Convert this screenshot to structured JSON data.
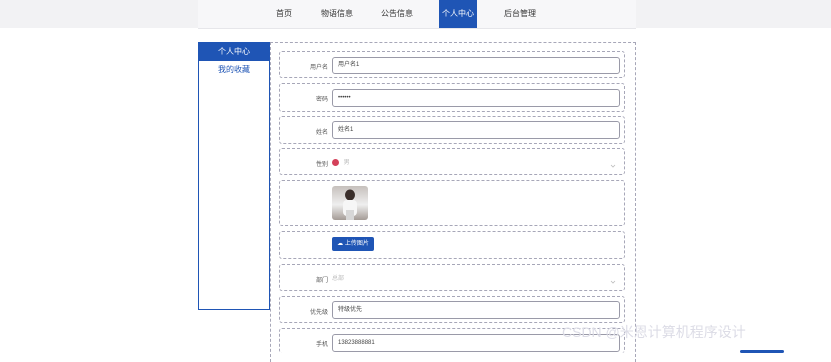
{
  "nav": {
    "items": [
      {
        "label": "首页"
      },
      {
        "label": "物语信息"
      },
      {
        "label": "公告信息"
      },
      {
        "label": "个人中心"
      },
      {
        "label": "后台管理"
      }
    ]
  },
  "sidebar": {
    "items": [
      {
        "label": "个人中心"
      },
      {
        "label": "我的收藏"
      }
    ]
  },
  "form": {
    "username": {
      "label": "用户名",
      "value": "用户名1"
    },
    "password": {
      "label": "密码",
      "value": "••••••"
    },
    "name": {
      "label": "姓名",
      "value": "姓名1"
    },
    "gender": {
      "label": "性别",
      "value": "男"
    },
    "upload": {
      "label": "上传图片"
    },
    "department": {
      "label": "部门",
      "value": "总部"
    },
    "priority": {
      "label": "优先级",
      "value": "特级优先"
    },
    "phone": {
      "label": "手机",
      "value": "13823888881"
    }
  },
  "watermark": {
    "text": "CSDN @米恩计算机程序设计"
  },
  "colors": {
    "accent": "#1f55b5"
  }
}
